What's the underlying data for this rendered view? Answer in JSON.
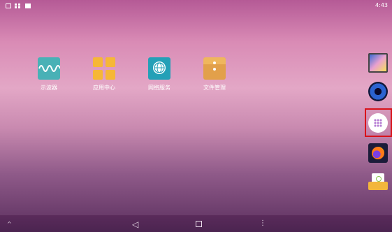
{
  "status_bar": {
    "time": "4:43"
  },
  "apps": [
    {
      "label": "示波器",
      "icon": "waveform-icon"
    },
    {
      "label": "应用中心",
      "icon": "apps-grid-icon"
    },
    {
      "label": "网络服务",
      "icon": "globe-icon"
    },
    {
      "label": "文件管理",
      "icon": "folder-icon"
    }
  ],
  "dock": [
    {
      "icon": "gallery-icon"
    },
    {
      "icon": "music-icon"
    },
    {
      "icon": "app-drawer-icon",
      "highlighted": true
    },
    {
      "icon": "firefox-icon"
    },
    {
      "icon": "email-icon"
    }
  ],
  "navbar": {
    "up": "^",
    "back": "◁",
    "menu": "⋮"
  },
  "colors": {
    "highlight": "#d9121a"
  }
}
